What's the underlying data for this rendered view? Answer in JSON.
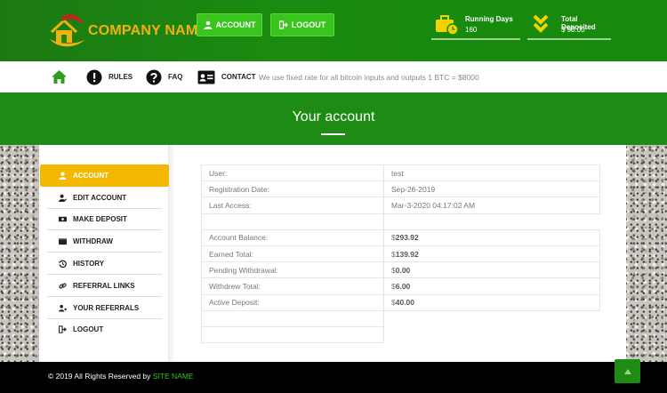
{
  "header": {
    "company_name": "COMPANY NAME",
    "account_button": "ACCOUNT",
    "logout_button": "LOGOUT",
    "stats": [
      {
        "label": "Running Days",
        "value": "160",
        "icon": "briefcase-clock-icon"
      },
      {
        "label": "Total Deposited",
        "value": "$ 90.00",
        "icon": "double-chevron-down-icon"
      }
    ],
    "colors": {
      "header_green": "#1a8a10",
      "button_green": "#39c51d",
      "accent_yellow": "#f2b10e"
    }
  },
  "nav": {
    "items": [
      {
        "label": "",
        "icon": "home-icon"
      },
      {
        "label": "RULES",
        "icon": "exclamation-circle-icon"
      },
      {
        "label": "FAQ",
        "icon": "question-circle-icon"
      },
      {
        "label": "CONTACT",
        "icon": "id-card-icon"
      }
    ],
    "rate_text": "We use fixed rate for all bitcoin inputs and outputs 1 BTC = $8000"
  },
  "page": {
    "title": "Your account"
  },
  "sidebar": {
    "items": [
      {
        "label": "ACCOUNT",
        "icon": "user-icon",
        "active": true
      },
      {
        "label": "EDIT ACCOUNT",
        "icon": "user-edit-icon"
      },
      {
        "label": "MAKE DEPOSIT",
        "icon": "money-bill-icon"
      },
      {
        "label": "WITHDRAW",
        "icon": "wallet-icon"
      },
      {
        "label": "HISTORY",
        "icon": "history-icon"
      },
      {
        "label": "REFERRAL LINKS",
        "icon": "link-icon"
      },
      {
        "label": "YOUR REFERRALS",
        "icon": "users-icon"
      },
      {
        "label": "LOGOUT",
        "icon": "sign-out-icon"
      }
    ],
    "active_color": "#f5b800"
  },
  "account": {
    "user_label": "User:",
    "user_value": "test",
    "registration_label": "Registration Date:",
    "registration_value": "Sep-26-2019",
    "last_access_label": "Last Access:",
    "last_access_value": "Mar-3-2020 04:17:02 AM",
    "balance_label": "Account Balance:",
    "balance_currency": "$",
    "balance_value": "293.92",
    "earned_label": "Earned Total:",
    "earned_currency": "$",
    "earned_value": "139.92",
    "pending_label": "Pending Withdrawal:",
    "pending_currency": "$",
    "pending_value": "0.00",
    "withdrew_label": "Withdrew Total:",
    "withdrew_currency": "$",
    "withdrew_value": "6.00",
    "active_label": "Active Deposit:",
    "active_currency": "$",
    "active_value": "40.00"
  },
  "footer": {
    "copyright": "© 2019 All Rights Reserved by",
    "site_name": "SITE NAME",
    "to_top_icon": "chevron-up-icon"
  }
}
